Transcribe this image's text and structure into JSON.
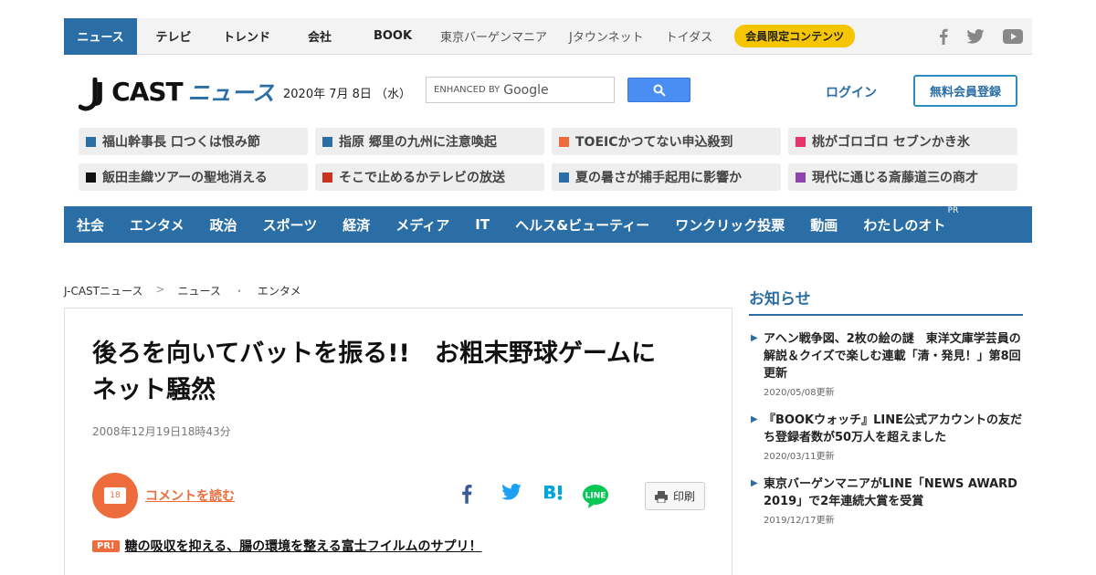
{
  "topnav": {
    "tabs": [
      "ニュース",
      "テレビ",
      "トレンド",
      "会社",
      "BOOK"
    ],
    "external": [
      "東京バーゲンマニア",
      "Jタウンネット",
      "トイダス"
    ],
    "member": "会員限定コンテンツ",
    "social_icons": [
      "facebook-icon",
      "twitter-icon",
      "youtube-icon"
    ]
  },
  "header": {
    "logo_jcast": "J CAST",
    "logo_news": "ニュース",
    "date": "2020年 7月 8日 （水）",
    "search_enhanced": "ENHANCED BY",
    "search_brand": "Google",
    "login": "ログイン",
    "register": "無料会員登録"
  },
  "chips": [
    {
      "text": "福山幹事長 口つくは恨み節",
      "color": "#2b6ea5"
    },
    {
      "text": "指原 郷里の九州に注意喚起",
      "color": "#2b6ea5"
    },
    {
      "text": "TOEICかつてない申込殺到",
      "color": "#ee6b3b"
    },
    {
      "text": "桃がゴロゴロ セブンかき氷",
      "color": "#e8336a"
    },
    {
      "text": "飯田圭織ツアーの聖地消える",
      "color": "#111111"
    },
    {
      "text": "そこで止めるかテレビの放送",
      "color": "#c9331f"
    },
    {
      "text": "夏の暑さが捕手起用に影響か",
      "color": "#2b6ea5"
    },
    {
      "text": "現代に通じる斎藤道三の商才",
      "color": "#8e44ad"
    }
  ],
  "categories": [
    "社会",
    "エンタメ",
    "政治",
    "スポーツ",
    "経済",
    "メディア",
    "IT",
    "ヘルス&ビューティー",
    "ワンクリック投票",
    "動画",
    "わたしのオト"
  ],
  "categories_pr": "PR",
  "breadcrumb": {
    "home": "J-CASTニュース",
    "sep1": ">",
    "section": "ニュース",
    "sep2": "・",
    "category": "エンタメ"
  },
  "article": {
    "title_line1": "後ろを向いてバットを振る!!　お粗末野球ゲームに",
    "title_line2": "ネット騒然",
    "published": "2008年12月19日18時43分",
    "comment_count": "18",
    "comment_link": "コメントを読む",
    "print": "印刷",
    "pr_tag": "PR!",
    "pr_text": "糖の吸収を抑える、腸の環境を整える富士フイルムのサプリ！"
  },
  "sidebar": {
    "title": "お知らせ",
    "items": [
      {
        "text": "アヘン戦争図、2枚の絵の謎　東洋文庫学芸員の解説＆クイズで楽しむ連載「清・発見！」第8回更新",
        "date": "2020/05/08更新"
      },
      {
        "text": "『BOOKウォッチ』LINE公式アカウントの友だち登録者数が50万人を超えました",
        "date": "2020/03/11更新"
      },
      {
        "text": "東京バーゲンマニアがLINE「NEWS AWARD 2019」で2年連続大賞を受賞",
        "date": "2019/12/17更新"
      }
    ]
  },
  "colors": {
    "brand_blue": "#2b6ea5",
    "accent_orange": "#ee6b3b",
    "member_yellow": "#f4c500"
  }
}
